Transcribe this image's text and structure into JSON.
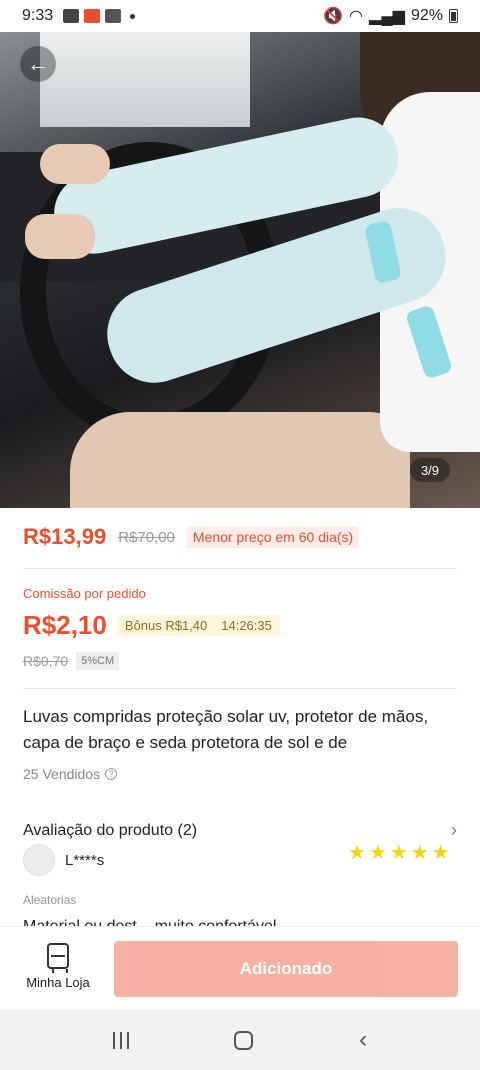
{
  "status_bar": {
    "time": "9:33",
    "battery": "92%"
  },
  "hero": {
    "image_counter": "3/9"
  },
  "price": {
    "current": "R$13,99",
    "original": "R$70,00",
    "badge": "Menor preço em 60 dia(s)"
  },
  "commission": {
    "label": "Comissão por pedido",
    "value": "R$2,10",
    "bonus": "Bônus R$1,40",
    "timer": "14:26:35",
    "old_value": "R$0,70",
    "rate": "5%CM"
  },
  "product": {
    "title": "Luvas compridas proteção solar uv, protetor de mãos, capa de braço e seda protetora de sol e de",
    "sold": "25 Vendidos"
  },
  "reviews": {
    "title": "Avaliação do produto (2)",
    "reviewer": "L****s",
    "rating": 5,
    "stars": [
      "★",
      "★",
      "★",
      "★",
      "★"
    ],
    "variation": "Aleatorias",
    "text": "Material ou dest... muito confortável..."
  },
  "action_bar": {
    "shop_label": "Minha Loja",
    "add_label": "Adicionado"
  },
  "colors": {
    "accent": "#ee4d2d",
    "button_disabled": "#f5a899",
    "star": "#f5d60a"
  }
}
